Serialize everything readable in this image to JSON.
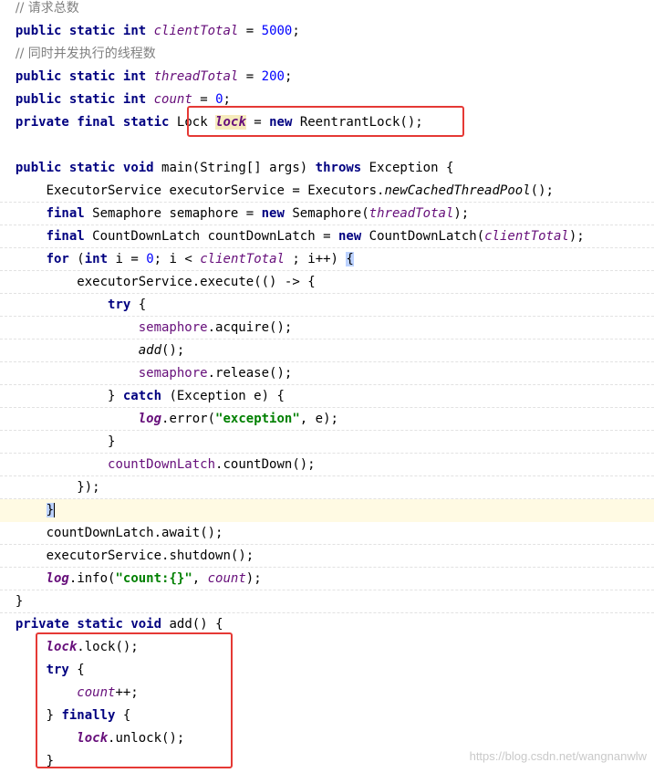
{
  "comments": {
    "client_total": "// 请求总数",
    "thread_total": "// 同时并发执行的线程数"
  },
  "keywords": {
    "public": "public",
    "private": "private",
    "static": "static",
    "final": "final",
    "int": "int",
    "void": "void",
    "new": "new",
    "throws": "throws",
    "for": "for",
    "try": "try",
    "catch": "catch",
    "finally": "finally"
  },
  "identifiers": {
    "client_total": "clientTotal",
    "thread_total": "threadTotal",
    "count": "count",
    "lock_type": "Lock",
    "lock": "lock",
    "reentrant_lock": "ReentrantLock",
    "main": "main",
    "string_array": "String[]",
    "args": "args",
    "exception": "Exception",
    "executor_service_type": "ExecutorService",
    "executor_service": "executorService",
    "executors": "Executors",
    "new_cached_thread_pool": "newCachedThreadPool",
    "semaphore_type": "Semaphore",
    "semaphore": "semaphore",
    "count_down_latch_type": "CountDownLatch",
    "count_down_latch": "countDownLatch",
    "i": "i",
    "execute": "execute",
    "acquire": "acquire",
    "add": "add",
    "release": "release",
    "e": "e",
    "log": "log",
    "error": "error",
    "count_down": "countDown",
    "await": "await",
    "shutdown": "shutdown",
    "info": "info",
    "lock_method": "lock",
    "unlock": "unlock"
  },
  "values": {
    "client_total": "5000",
    "thread_total": "200",
    "count_init": "0",
    "loop_start": "0"
  },
  "strings": {
    "exception_msg": "\"exception\"",
    "count_fmt": "\"count:{}\""
  },
  "watermark": "https://blog.csdn.net/wangnanwlw"
}
